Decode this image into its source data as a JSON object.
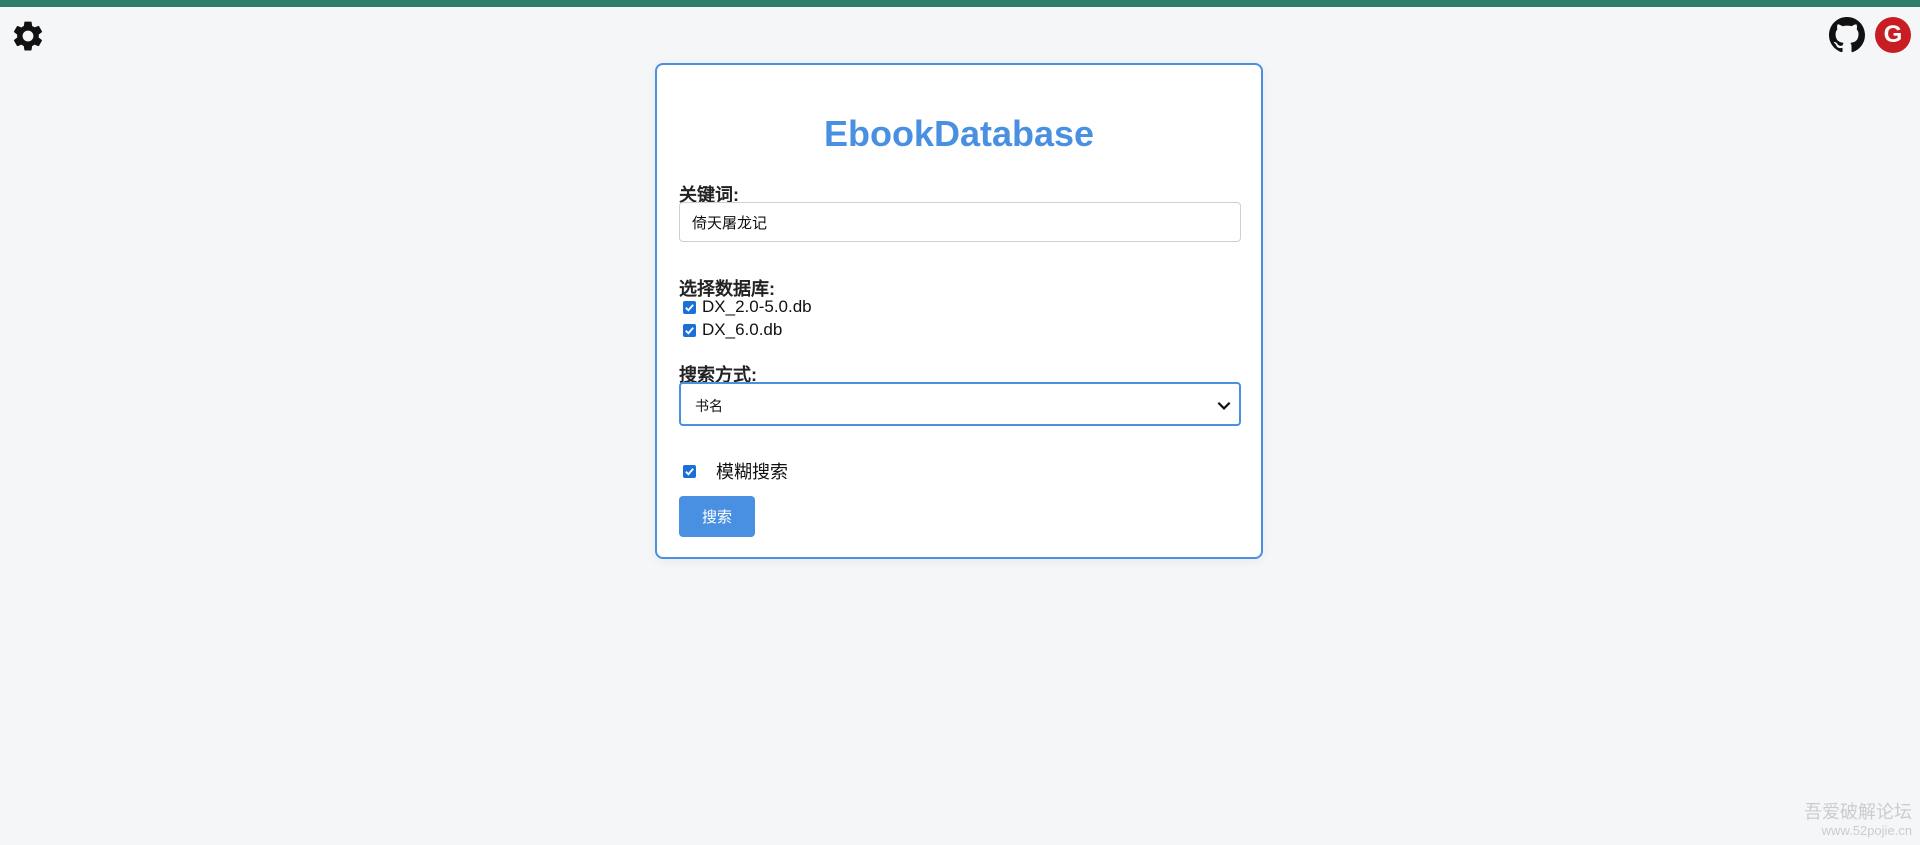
{
  "colors": {
    "accent": "#4a90e2",
    "topbar": "#2e7d6a",
    "gitee": "#c71d23",
    "background": "#f5f6f8"
  },
  "header": {
    "settings_icon": "gear-icon",
    "github_icon": "github-icon",
    "gitee_icon": "gitee-icon",
    "gitee_letter": "G"
  },
  "form": {
    "title": "EbookDatabase",
    "keyword_label": "关键词:",
    "keyword_value": "倚天屠龙记",
    "database_label": "选择数据库:",
    "databases": [
      {
        "name": "DX_2.0-5.0.db",
        "checked": true
      },
      {
        "name": "DX_6.0.db",
        "checked": true
      }
    ],
    "search_mode_label": "搜索方式:",
    "search_mode_value": "书名",
    "fuzzy_label": "模糊搜索",
    "fuzzy_checked": true,
    "search_button": "搜索"
  },
  "watermark": {
    "line1": "吾爱破解论坛",
    "line2": "www.52pojie.cn"
  }
}
